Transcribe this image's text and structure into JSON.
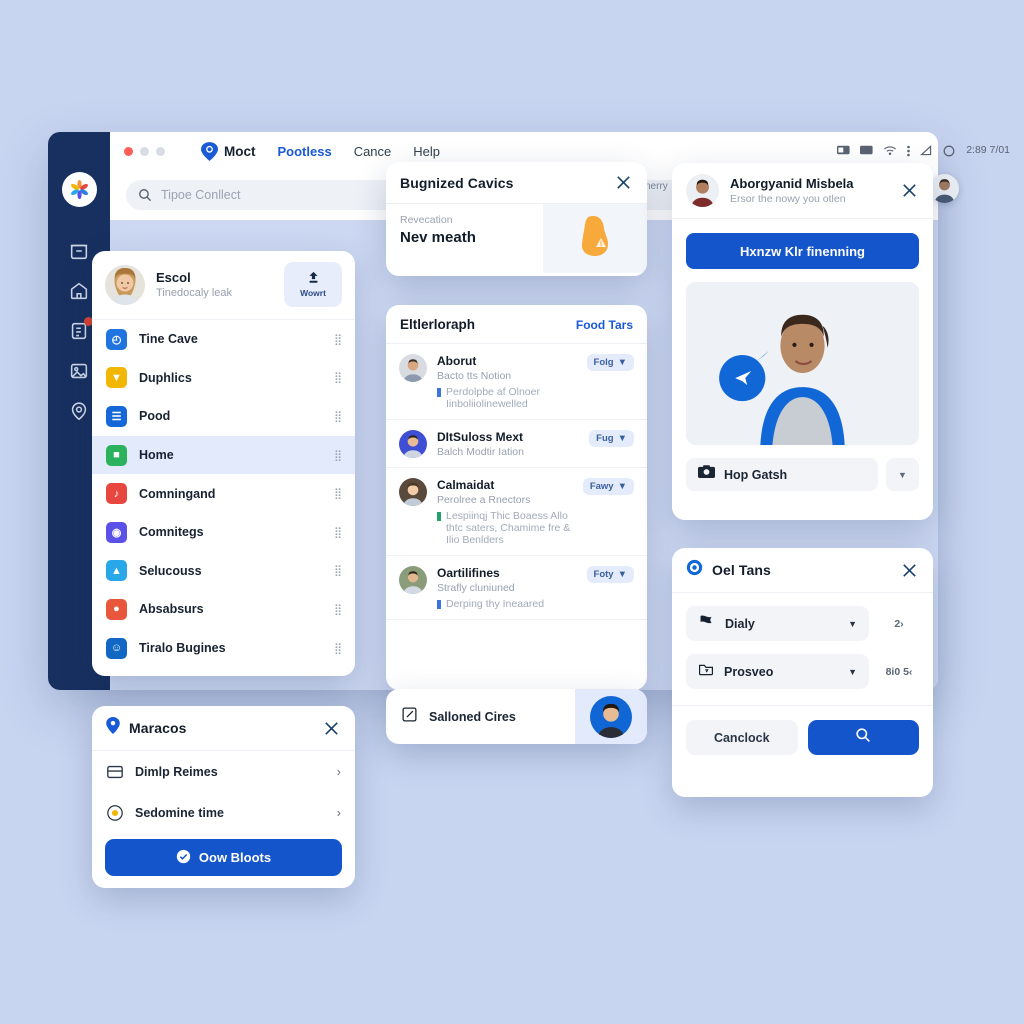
{
  "theme": {
    "background": "#c8d5f1",
    "primary": "#1455cc",
    "rail": "#17305f",
    "canvas": "#ccd8f2",
    "accent_text": "#1a5ad6"
  },
  "window": {
    "traffic_lights": [
      "#ff5f57",
      "#febc2e",
      "#28c840"
    ],
    "menu": {
      "brand": "Moct",
      "brand_icon": "shield-pin-icon",
      "items": [
        {
          "label": "Pootless",
          "accent": true
        },
        {
          "label": "Cance",
          "accent": false
        },
        {
          "label": "Help",
          "accent": false
        }
      ]
    },
    "search": {
      "placeholder": "Tipoe Conllect",
      "value": "",
      "icon": "search-icon",
      "send_icon": "send-icon"
    },
    "rail": {
      "logo_icon": "flower-logo-icon",
      "items": [
        {
          "icon": "archive-box-icon",
          "badge": false
        },
        {
          "icon": "home-icon",
          "badge": false
        },
        {
          "icon": "document-icon",
          "badge": true
        },
        {
          "icon": "image-icon",
          "badge": false
        },
        {
          "icon": "chat-pin-icon",
          "badge": false
        }
      ]
    },
    "statusbar": {
      "icons": [
        "battery-icon",
        "display-icon",
        "wifi-icon",
        "menu-dots-icon",
        "volume-icon",
        "circle-icon"
      ],
      "time": "2:89 7/01"
    },
    "edge_word": "nerry"
  },
  "apps_card": {
    "profile": {
      "name": "Escol",
      "subtitle": "Tinedocaly leak",
      "button_icon": "upload-icon",
      "button_label": "Wowrt"
    },
    "items": [
      {
        "label": "Tine Cave",
        "icon_glyph": "◴",
        "icon_color": "#1f74e0",
        "selected": false
      },
      {
        "label": "Duphlics",
        "icon_glyph": "▼",
        "icon_color": "#f2b705",
        "selected": false
      },
      {
        "label": "Pood",
        "icon_glyph": "☰",
        "icon_color": "#1667d8",
        "selected": false
      },
      {
        "label": "Home",
        "icon_glyph": "■",
        "icon_color": "#2bb25c",
        "selected": true
      },
      {
        "label": "Comningand",
        "icon_glyph": "♪",
        "icon_color": "#e8473f",
        "selected": false
      },
      {
        "label": "Comnitegs",
        "icon_glyph": "◉",
        "icon_color": "#5b51e8",
        "selected": false
      },
      {
        "label": "Selucouss",
        "icon_glyph": "▲",
        "icon_color": "#28a8e8",
        "selected": false
      },
      {
        "label": "Absabsurs",
        "icon_glyph": "●",
        "icon_color": "#e8573c",
        "selected": false
      },
      {
        "label": "Tiralo Bugines",
        "icon_glyph": "☺",
        "icon_color": "#1167c4",
        "selected": false
      }
    ],
    "grip_icon": "drag-grip-icon"
  },
  "maracos_card": {
    "title": "Maracos",
    "title_icon": "location-pin-icon",
    "close_icon": "close-icon",
    "rows": [
      {
        "label": "Dimlp Reimes",
        "icon": "card-icon",
        "chevron": "›"
      },
      {
        "label": "Sedomine time",
        "icon": "radio-dot-icon",
        "chevron": "›"
      }
    ],
    "cta": {
      "label": "Oow Bloots",
      "icon": "check-circle-icon"
    }
  },
  "cavics_card": {
    "title": "Bugnized Cavics",
    "close_icon": "close-icon",
    "kicker": "Revecation",
    "headline": "Nev meath",
    "thumb_icon": "warning-shape-icon"
  },
  "people_card": {
    "title": "Eltlerloraph",
    "link": "Food Tars",
    "rows": [
      {
        "name": "Aborut",
        "subtitle": "Bacto tts Notion",
        "tag": "Folg",
        "note": "Perdolpbe af Olnoer Iinboliiolinewelled",
        "note_color": "blue"
      },
      {
        "name": "DItSuloss Mext",
        "subtitle": "Balch Modtir Iation",
        "tag": "Fug",
        "note": "",
        "note_color": "blue"
      },
      {
        "name": "Calmaidat",
        "subtitle": "Perolree a Rnectors",
        "tag": "Fawy",
        "note": "Lespiinqj Thic Boaess Allo thtc saters, Chamime fre & Ilio Benlders",
        "note_color": "green"
      },
      {
        "name": "Oartilifines",
        "subtitle": "Strafly cluniuned",
        "tag": "Foty",
        "note": "Derping thy Ineaared",
        "note_color": "blue"
      }
    ],
    "tag_caret": "▼"
  },
  "compose_card": {
    "label": "Salloned Cires",
    "icon": "compose-square-icon"
  },
  "profile_card": {
    "name": "Aborgyanid Misbela",
    "subtitle": "Ersor the nowy you otlen",
    "close_icon": "close-icon",
    "cta": "Hxnzw Klr finenning",
    "media_badge_icon": "send-arrow-icon",
    "footer": {
      "field_icon": "gallery-icon",
      "field_label": "Hop Gatsh",
      "dropdown_caret": "▼"
    }
  },
  "tans_card": {
    "title": "Oel Tans",
    "title_icon": "target-icon",
    "close_icon": "close-icon",
    "selects": [
      {
        "label": "Dialy",
        "icon": "flag-icon",
        "caret": "▼",
        "meta": "2›"
      },
      {
        "label": "Prosveo",
        "icon": "folder-icon",
        "caret": "▼",
        "meta": "8i0 5‹"
      }
    ],
    "cancel_label": "Canclock",
    "confirm_icon": "search-icon"
  }
}
